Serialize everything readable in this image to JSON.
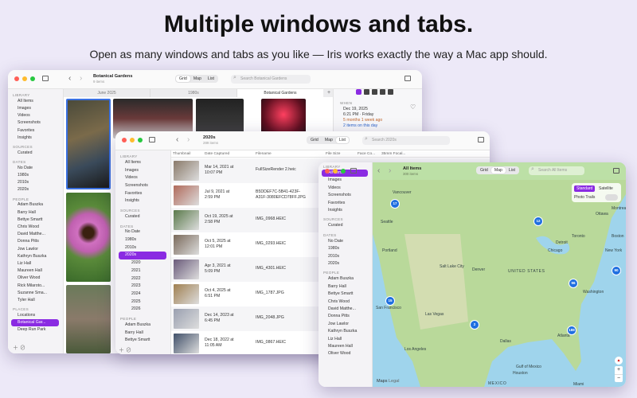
{
  "hero": {
    "title": "Multiple windows and tabs.",
    "subtitle": "Open as many windows and tabs as you like — Iris works exactly the way a Mac app should."
  },
  "win1": {
    "title": "Botanical Gardens",
    "count": "9 items",
    "view_seg": [
      "Grid",
      "Map",
      "List"
    ],
    "search_placeholder": "Search Botanical Gardens",
    "tabs": [
      "June 2025",
      "1980s",
      "Botanical Gardens"
    ],
    "sidebar": [
      {
        "t": "h",
        "label": "LIBRARY"
      },
      {
        "t": "i",
        "label": "All Items"
      },
      {
        "t": "i",
        "label": "Images"
      },
      {
        "t": "i",
        "label": "Videos"
      },
      {
        "t": "i",
        "label": "Screenshots"
      },
      {
        "t": "i",
        "label": "Favorites"
      },
      {
        "t": "i",
        "label": "Insights"
      },
      {
        "t": "h",
        "label": "SOURCES"
      },
      {
        "t": "i",
        "label": "Curated"
      },
      {
        "t": "h",
        "label": "DATES"
      },
      {
        "t": "i",
        "label": "No Date"
      },
      {
        "t": "i",
        "label": "1980s"
      },
      {
        "t": "i",
        "label": "2010s"
      },
      {
        "t": "i",
        "label": "2020s"
      },
      {
        "t": "h",
        "label": "PEOPLE"
      },
      {
        "t": "i",
        "label": "Adam Buszka"
      },
      {
        "t": "i",
        "label": "Barry Hall"
      },
      {
        "t": "i",
        "label": "Bettye Smartt"
      },
      {
        "t": "i",
        "label": "Chris Wood"
      },
      {
        "t": "i",
        "label": "David Matthe..."
      },
      {
        "t": "i",
        "label": "Donna Pitts"
      },
      {
        "t": "i",
        "label": "Jow Lawlor"
      },
      {
        "t": "i",
        "label": "Kathryn Buszka"
      },
      {
        "t": "i",
        "label": "Liz Hall"
      },
      {
        "t": "i",
        "label": "Maureen Hall"
      },
      {
        "t": "i",
        "label": "Oliver Wood"
      },
      {
        "t": "i",
        "label": "Rick Milaroto..."
      },
      {
        "t": "i",
        "label": "Suzanne Sma..."
      },
      {
        "t": "i",
        "label": "Tyler Hall"
      },
      {
        "t": "h",
        "label": "PLACES"
      },
      {
        "t": "i",
        "label": "Locations"
      },
      {
        "t": "s",
        "label": "Botanical Gar..."
      },
      {
        "t": "i",
        "label": "Deep Run Park"
      }
    ],
    "info": {
      "when": "WHEN",
      "date": "Dec 19, 2025",
      "time": "6:21 PM · Friday",
      "ago": "5 months 1 week ago",
      "same_day": "2 items on this day"
    }
  },
  "win2": {
    "title": "2020s",
    "count": "289 items",
    "view_seg": [
      "Grid",
      "Map",
      "List"
    ],
    "search_placeholder": "Search 2020s",
    "sidebar": [
      {
        "t": "h",
        "label": "LIBRARY"
      },
      {
        "t": "i",
        "label": "All Items"
      },
      {
        "t": "i",
        "label": "Images"
      },
      {
        "t": "i",
        "label": "Videos"
      },
      {
        "t": "i",
        "label": "Screenshots"
      },
      {
        "t": "i",
        "label": "Favorites"
      },
      {
        "t": "i",
        "label": "Insights"
      },
      {
        "t": "h",
        "label": "SOURCES"
      },
      {
        "t": "i",
        "label": "Curated"
      },
      {
        "t": "h",
        "label": "DATES"
      },
      {
        "t": "i",
        "label": "No Date"
      },
      {
        "t": "i",
        "label": "1980s"
      },
      {
        "t": "i",
        "label": "2010s"
      },
      {
        "t": "s",
        "label": "2020s"
      },
      {
        "t": "i",
        "label": "2020"
      },
      {
        "t": "i",
        "label": "2021"
      },
      {
        "t": "i",
        "label": "2022"
      },
      {
        "t": "i",
        "label": "2023"
      },
      {
        "t": "i",
        "label": "2024"
      },
      {
        "t": "i",
        "label": "2025"
      },
      {
        "t": "i",
        "label": "2026"
      },
      {
        "t": "h",
        "label": "PEOPLE"
      },
      {
        "t": "i",
        "label": "Adam Buszka"
      },
      {
        "t": "i",
        "label": "Barry Hall"
      },
      {
        "t": "i",
        "label": "Bettye Smartt"
      }
    ],
    "columns": [
      "Thumbnail",
      "Date Captured",
      "Filename",
      "File Size",
      "Face Co...",
      "35mm Focal..."
    ],
    "rows": [
      {
        "date": "Mar 14, 2021 at\n10:07 PM",
        "file": "FullSizeRender 2.heic"
      },
      {
        "date": "Jul 9, 2021 at\n2:59 PM",
        "file": "B5DDEF7C-5B41-423F-\nA31F-3080EFCD78FF.JPG"
      },
      {
        "date": "Oct 19, 2025 at\n2:58 PM",
        "file": "IMG_0968.HEIC"
      },
      {
        "date": "Oct 5, 2025 at\n12:01 PM",
        "file": "IMG_0293.HEIC"
      },
      {
        "date": "Apr 3, 2021 at\n5:09 PM",
        "file": "IMG_4301.HEIC"
      },
      {
        "date": "Oct 4, 2025 at\n6:51 PM",
        "file": "IMG_1787.JPG"
      },
      {
        "date": "Dec 14, 2023 at\n6:45 PM",
        "file": "IMG_2048.JPG"
      },
      {
        "date": "Dec 18, 2022 at\n11:05 AM",
        "file": "IMG_0867.HEIC"
      }
    ]
  },
  "win3": {
    "title": "All Items",
    "count": "300 items",
    "view_seg": [
      "Grid",
      "Map",
      "List"
    ],
    "search_placeholder": "Search All Items",
    "map_style": [
      "Standard",
      "Satellite"
    ],
    "photo_trails": "Photo Trails",
    "sidebar": [
      {
        "t": "h",
        "label": "LIBRARY"
      },
      {
        "t": "s",
        "label": "All Items"
      },
      {
        "t": "i",
        "label": "Images"
      },
      {
        "t": "i",
        "label": "Videos"
      },
      {
        "t": "i",
        "label": "Screenshots"
      },
      {
        "t": "i",
        "label": "Favorites"
      },
      {
        "t": "i",
        "label": "Insights"
      },
      {
        "t": "h",
        "label": "SOURCES"
      },
      {
        "t": "i",
        "label": "Curated"
      },
      {
        "t": "h",
        "label": "DATES"
      },
      {
        "t": "i",
        "label": "No Date"
      },
      {
        "t": "i",
        "label": "1980s"
      },
      {
        "t": "i",
        "label": "2010s"
      },
      {
        "t": "i",
        "label": "2020s"
      },
      {
        "t": "h",
        "label": "PEOPLE"
      },
      {
        "t": "i",
        "label": "Adam Buszka"
      },
      {
        "t": "i",
        "label": "Barry Hall"
      },
      {
        "t": "i",
        "label": "Bettye Smartt"
      },
      {
        "t": "i",
        "label": "Chris Wood"
      },
      {
        "t": "i",
        "label": "David Matthe..."
      },
      {
        "t": "i",
        "label": "Donna Pitts"
      },
      {
        "t": "i",
        "label": "Jow Lawlor"
      },
      {
        "t": "i",
        "label": "Kathryn Buszka"
      },
      {
        "t": "i",
        "label": "Liz Hall"
      },
      {
        "t": "i",
        "label": "Maureen Hall"
      },
      {
        "t": "i",
        "label": "Oliver Wood"
      }
    ],
    "markers": [
      "17",
      "12",
      "96",
      "90",
      "188",
      "2",
      "15"
    ],
    "places": [
      "Vancouver",
      "Seattle",
      "Portland",
      "San Francisco",
      "Las Vegas",
      "Los Angeles",
      "Salt Lake City",
      "Denver",
      "Dallas",
      "Houston",
      "Chicago",
      "New York",
      "Washington",
      "Toronto",
      "Ottawa",
      "Montreal",
      "Atlanta",
      "Miami",
      "Detroit",
      "Boston",
      "UNITED STATES",
      "MEXICO",
      "Gulf of Mexico"
    ],
    "attrib": [
      "Maps",
      "Legal"
    ],
    "colors": {
      "land": "#b9d99a",
      "water": "#9fd4ec",
      "marker": "#1f6fe0"
    }
  }
}
